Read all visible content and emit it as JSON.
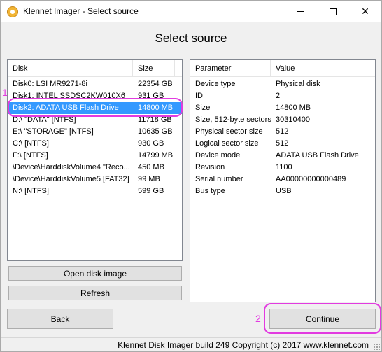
{
  "window": {
    "title": "Klennet Imager - Select source",
    "icon": "app-logo-icon"
  },
  "page": {
    "heading": "Select source"
  },
  "disk_list": {
    "columns": [
      "Disk",
      "Size"
    ],
    "rows": [
      {
        "disk": "Disk0: LSI MR9271-8i",
        "size": "22354 GB"
      },
      {
        "disk": "Disk1: INTEL SSDSC2KW010X6",
        "size": "931 GB"
      },
      {
        "disk": "Disk2: ADATA USB Flash Drive",
        "size": "14800 MB",
        "selected": true
      },
      {
        "disk": "D:\\ \"DATA\" [NTFS]",
        "size": "11718 GB"
      },
      {
        "disk": "E:\\ \"STORAGE\" [NTFS]",
        "size": "10635 GB"
      },
      {
        "disk": "C:\\ [NTFS]",
        "size": "930 GB"
      },
      {
        "disk": "F:\\ [NTFS]",
        "size": "14799 MB"
      },
      {
        "disk": "\\Device\\HarddiskVolume4 \"Reco...",
        "size": "450 MB"
      },
      {
        "disk": "\\Device\\HarddiskVolume5 [FAT32]",
        "size": "99 MB"
      },
      {
        "disk": "N:\\ [NTFS]",
        "size": "599 GB"
      }
    ]
  },
  "details": {
    "columns": [
      "Parameter",
      "Value"
    ],
    "rows": [
      {
        "parameter": "Device type",
        "value": "Physical disk"
      },
      {
        "parameter": "ID",
        "value": "2"
      },
      {
        "parameter": "Size",
        "value": "14800 MB"
      },
      {
        "parameter": "Size, 512-byte sectors",
        "value": "30310400"
      },
      {
        "parameter": "Physical sector size",
        "value": "512"
      },
      {
        "parameter": "Logical sector size",
        "value": "512"
      },
      {
        "parameter": "Device model",
        "value": "ADATA USB Flash Drive"
      },
      {
        "parameter": "Revision",
        "value": "1100"
      },
      {
        "parameter": "Serial number",
        "value": "AA00000000000489"
      },
      {
        "parameter": "Bus type",
        "value": "USB"
      }
    ]
  },
  "buttons": {
    "open_disk_image": "Open disk image",
    "refresh": "Refresh",
    "back": "Back",
    "continue": "Continue"
  },
  "annotations": {
    "marker_1": "1",
    "marker_2": "2",
    "color": "#e23be0"
  },
  "status_bar": {
    "text": "Klennet Disk Imager build 249 Copyright (c) 2017 www.klennet.com"
  },
  "colors": {
    "selection": "#3399ff",
    "window_bg": "#f0f0f0"
  }
}
